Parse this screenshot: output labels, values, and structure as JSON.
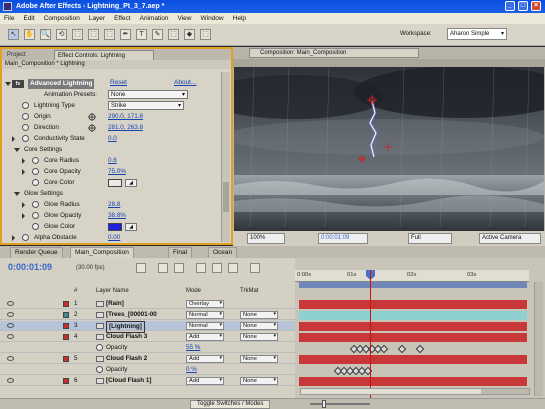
{
  "window": {
    "title": "Adobe After Effects - Lightning_Pt_3_7.aep *",
    "minimize_label": "_",
    "maximize_label": "□",
    "close_label": "×"
  },
  "menu": [
    "File",
    "Edit",
    "Composition",
    "Layer",
    "Effect",
    "Animation",
    "View",
    "Window",
    "Help"
  ],
  "toolbar": {
    "workspace_label": "Workspace:",
    "workspace_value": "Aharon Simple",
    "tools": [
      "↖",
      "✋",
      "🔍",
      "⟲",
      "⬚",
      "⬚",
      "⬚",
      "✒",
      "T",
      "✎",
      "⬚",
      "◆",
      "⬚"
    ]
  },
  "effect_controls": {
    "project_tab": "Project",
    "tab_label": "Effect Controls: Lightning",
    "subtitle": "Main_Composition * Lightning",
    "effect_name": "Advanced Lightning",
    "fx_badge": "fx",
    "reset": "Reset",
    "about": "About...",
    "animation_presets_label": "Animation Presets:",
    "animation_presets_value": "None",
    "lightning_type_label": "Lightning Type",
    "lightning_type_value": "Strike",
    "origin_label": "Origin",
    "origin_value": "290.0, 171.8",
    "direction_label": "Direction",
    "direction_value": "281.0, 263.8",
    "conductivity_label": "Conductivity State",
    "conductivity_value": "0.0",
    "core_settings_label": "Core Settings",
    "core_radius_label": "Core Radius",
    "core_radius_value": "0.6",
    "core_opacity_label": "Core Opacity",
    "core_opacity_value": "75.0%",
    "core_color_label": "Core Color",
    "glow_settings_label": "Glow Settings",
    "glow_radius_label": "Glow Radius",
    "glow_radius_value": "28.8",
    "glow_opacity_label": "Glow Opacity",
    "glow_opacity_value": "38.8%",
    "glow_color_label": "Glow Color",
    "alpha_obstacle_label": "Alpha Obstacle",
    "alpha_obstacle_value": "0.00",
    "eyedropper_label": "◢",
    "core_color": "#e8e8e8",
    "glow_color": "#2020e0"
  },
  "comp": {
    "tab_label": "Composition: Main_Composition",
    "zoom": "100%",
    "timecode": "0:00:01:09",
    "resolution": "Full",
    "camera": "Active Camera"
  },
  "timeline": {
    "tabs": [
      "Render Queue",
      "Main_Composition",
      "Final",
      "Ocean"
    ],
    "timecode": "0:00:01:09",
    "fps": "(30.00 fps)",
    "col_layer_name": "Layer Name",
    "col_num": "#",
    "col_mode": "Mode",
    "col_trkmat": "TrkMat",
    "ruler": [
      "0:00s",
      "01s",
      "02s",
      "03s"
    ],
    "toggle_label": "Toggle Switches / Modes",
    "layers": [
      {
        "num": "1",
        "name": "[Rain]",
        "mode": "Overlay",
        "trkmat": "",
        "color": "#c83030",
        "bar": "#c83838"
      },
      {
        "num": "2",
        "name": "[Trees_[00001-00",
        "mode": "Normal",
        "trkmat": "None",
        "color": "#3a9090",
        "bar": "#8ecfcf"
      },
      {
        "num": "3",
        "name": "[Lightning]",
        "mode": "Normal",
        "trkmat": "None",
        "color": "#c83030",
        "bar": "#c83838"
      },
      {
        "num": "4",
        "name": "Cloud Flash 3",
        "mode": "Add",
        "trkmat": "None",
        "color": "#c83030",
        "bar": "#c83838"
      },
      {
        "num": "",
        "name": "Opacity",
        "value": "55 %",
        "prop": true
      },
      {
        "num": "5",
        "name": "Cloud Flash 2",
        "mode": "Add",
        "trkmat": "None",
        "color": "#c83030",
        "bar": "#c83838"
      },
      {
        "num": "",
        "name": "Opacity",
        "value": "0 %",
        "prop": true
      },
      {
        "num": "6",
        "name": "[Cloud Flash 1]",
        "mode": "Add",
        "trkmat": "None",
        "color": "#c83030",
        "bar": "#c83838"
      }
    ]
  }
}
